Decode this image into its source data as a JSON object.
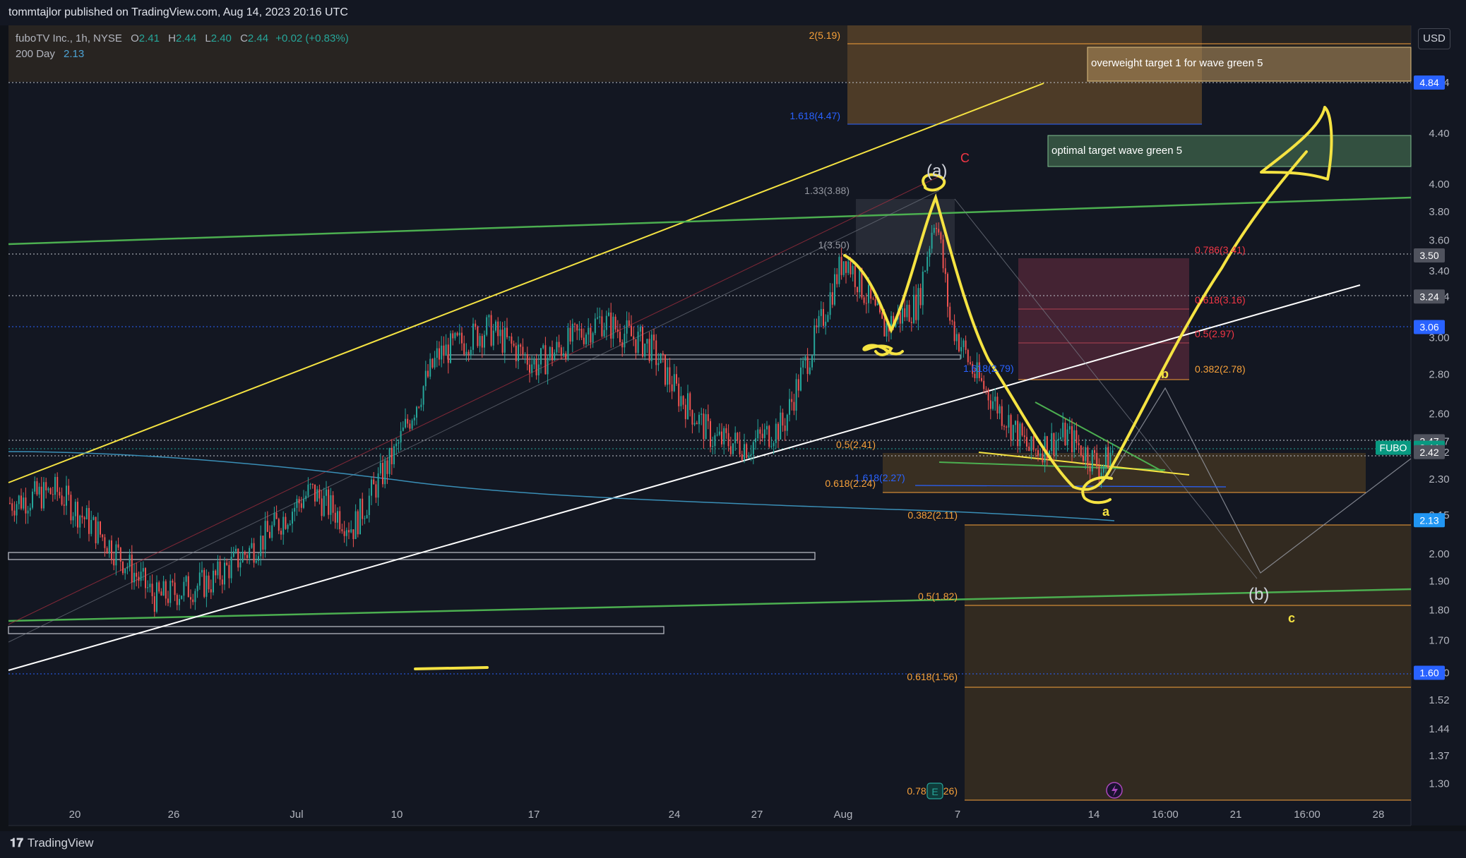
{
  "header": {
    "published_by": "tommtajlor published on TradingView.com, Aug 14, 2023 20:16 UTC"
  },
  "legend": {
    "symbol": "fuboTV Inc., 1h, NYSE",
    "open_label": "O",
    "open": "2.41",
    "high_label": "H",
    "high": "2.44",
    "low_label": "L",
    "low": "2.40",
    "close_label": "C",
    "close": "2.44",
    "change": "+0.02 (+0.83%)",
    "ma_label": "200 Day",
    "ma_value": "2.13"
  },
  "currency_button": "USD",
  "footer": {
    "brand": "TradingView",
    "logo": "tradingview-logo"
  },
  "chart_data": {
    "type": "candlestick",
    "symbol": "FUBO",
    "timeframe": "1h",
    "y_scale": "log",
    "ylim": [
      1.26,
      5.25
    ],
    "y_ticks": [
      "1.30",
      "1.37",
      "1.44",
      "1.52",
      "1.60",
      "1.70",
      "1.80",
      "1.90",
      "2.00",
      "2.15",
      "2.30",
      "2.42",
      "2.47",
      "2.60",
      "2.80",
      "3.00",
      "3.24",
      "3.40",
      "3.60",
      "3.80",
      "4.00",
      "4.40",
      "4.84"
    ],
    "price_tags": [
      {
        "price": 4.84,
        "label": "4.84",
        "color": "#2962ff"
      },
      {
        "price": 3.5,
        "label": "3.50",
        "color": "#50535e"
      },
      {
        "price": 3.24,
        "label": "3.24",
        "color": "#50535e"
      },
      {
        "price": 3.06,
        "label": "3.06",
        "color": "#2962ff"
      },
      {
        "price": 2.47,
        "label": "2.47",
        "color": "#50535e"
      },
      {
        "price": 2.44,
        "label": "2.44",
        "color": "#089981"
      },
      {
        "price": 2.42,
        "label": "2.42",
        "color": "#50535e"
      },
      {
        "price": 2.13,
        "label": "2.13",
        "color": "#2196f3"
      },
      {
        "price": 1.6,
        "label": "1.60",
        "color": "#2962ff"
      }
    ],
    "symbol_tag": "FUBO",
    "x_ticks": [
      "20",
      "26",
      "Jul",
      "10",
      "17",
      "24",
      "27",
      "Aug",
      "7",
      "14",
      "16:00",
      "21",
      "16:00",
      "28"
    ],
    "fib_labels": [
      {
        "text": "2(5.19)",
        "price": 5.19,
        "color": "#f7a13a"
      },
      {
        "text": "1.618(4.47)",
        "price": 4.47,
        "color": "#2962ff"
      },
      {
        "text": "1.33(3.88)",
        "price": 3.88,
        "color": "#9598a1"
      },
      {
        "text": "1(3.50)",
        "price": 3.5,
        "color": "#9598a1"
      },
      {
        "text": "1.618(2.79)",
        "price": 2.79,
        "color": "#2962ff"
      },
      {
        "text": "0.5(2.41)",
        "price": 2.41,
        "color": "#f7a13a"
      },
      {
        "text": "1.618(2.27)",
        "price": 2.27,
        "color": "#2962ff"
      },
      {
        "text": "0.618(2.24)",
        "price": 2.24,
        "color": "#f7a13a"
      },
      {
        "text": "0.382(2.11)",
        "price": 2.11,
        "color": "#f7a13a"
      },
      {
        "text": "0.5(1.82)",
        "price": 1.82,
        "color": "#f7a13a"
      },
      {
        "text": "0.618(1.56)",
        "price": 1.56,
        "color": "#f7a13a"
      },
      {
        "text": "0.786(1.26)",
        "price": 1.26,
        "color": "#f7a13a"
      },
      {
        "text": "0.786(3.41)",
        "price": 3.41,
        "color": "#f23645"
      },
      {
        "text": "0.618(3.16)",
        "price": 3.16,
        "color": "#f23645"
      },
      {
        "text": "0.5(2.97)",
        "price": 2.97,
        "color": "#f23645"
      },
      {
        "text": "0.382(2.78)",
        "price": 2.78,
        "color": "#f7a13a"
      }
    ],
    "annotations": [
      {
        "text": "overweight target 1 for wave green 5"
      },
      {
        "text": "optimal target wave green 5"
      },
      {
        "text": "(a)"
      },
      {
        "text": "C"
      },
      {
        "text": "(b)"
      },
      {
        "text": "a"
      },
      {
        "text": "b"
      },
      {
        "text": "c"
      }
    ],
    "events": [
      {
        "text": "E"
      }
    ]
  }
}
